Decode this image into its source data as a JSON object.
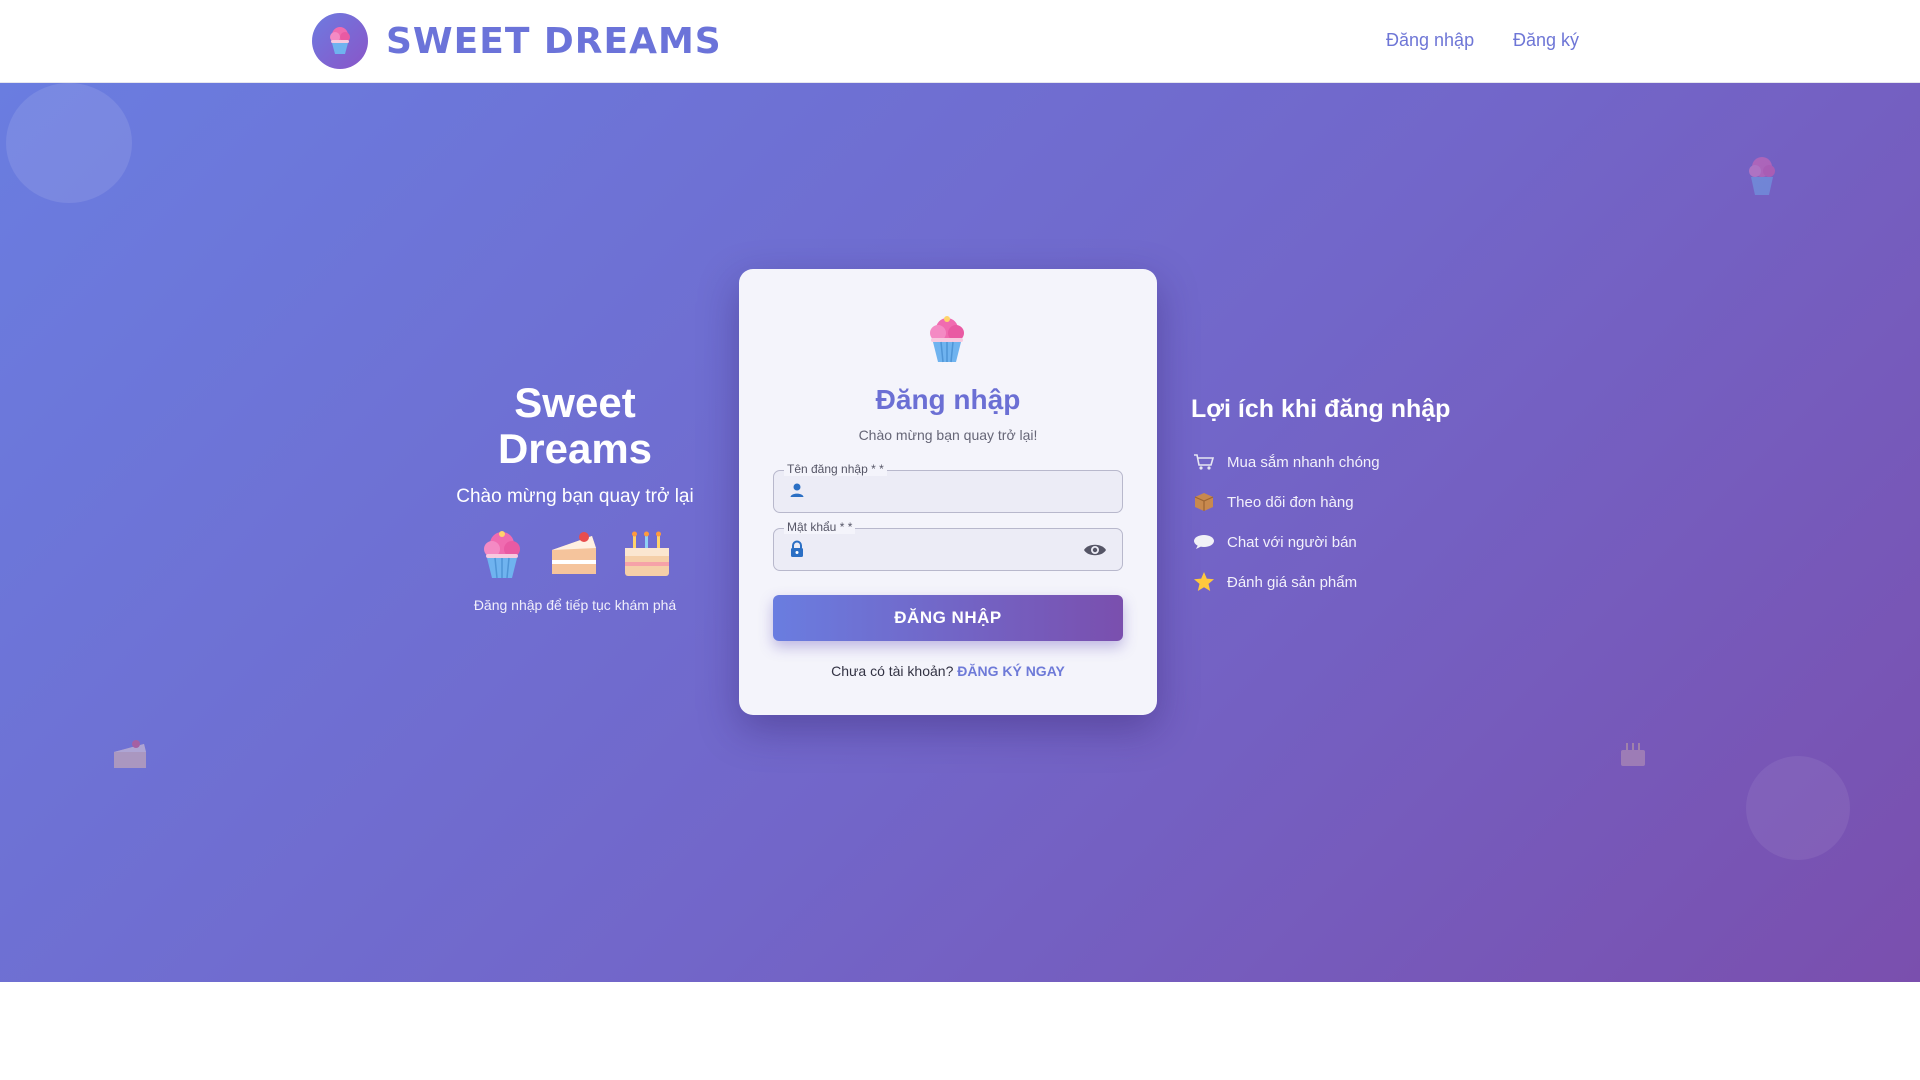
{
  "header": {
    "brand_name": "SWEET DREAMS",
    "logo_icon": "cupcake-icon",
    "nav": {
      "login": "Đăng nhập",
      "register": "Đăng ký"
    }
  },
  "hero": {
    "left": {
      "title_line1": "Sweet",
      "title_line2": "Dreams",
      "subtitle": "Chào mừng bạn quay trở lại",
      "caption": "Đăng nhập để tiếp tục khám phá",
      "icons": [
        "cupcake-icon",
        "cake-slice-icon",
        "birthday-cake-icon"
      ]
    },
    "card": {
      "icon": "cupcake-icon",
      "title": "Đăng nhập",
      "subtitle": "Chào mừng bạn quay trở lại!",
      "username_label": "Tên đăng nhập * *",
      "username_value": "",
      "password_label": "Mật khẩu * *",
      "password_value": "",
      "submit_label": "ĐĂNG NHẬP",
      "footer_text": "Chưa có tài khoản?",
      "footer_link": "ĐĂNG KÝ NGAY"
    },
    "right": {
      "title": "Lợi ích khi đăng nhập",
      "benefits": [
        {
          "icon": "cart-icon",
          "text": "Mua sắm nhanh chóng"
        },
        {
          "icon": "package-icon",
          "text": "Theo dõi đơn hàng"
        },
        {
          "icon": "chat-bubble-icon",
          "text": "Chat với người bán"
        },
        {
          "icon": "star-icon",
          "text": "Đánh giá sản phẩm"
        }
      ]
    }
  },
  "colors": {
    "brand": "#6b73d9",
    "gradient_start": "#6a7de0",
    "gradient_end": "#7a4fae",
    "card_bg": "#f4f4fb"
  }
}
